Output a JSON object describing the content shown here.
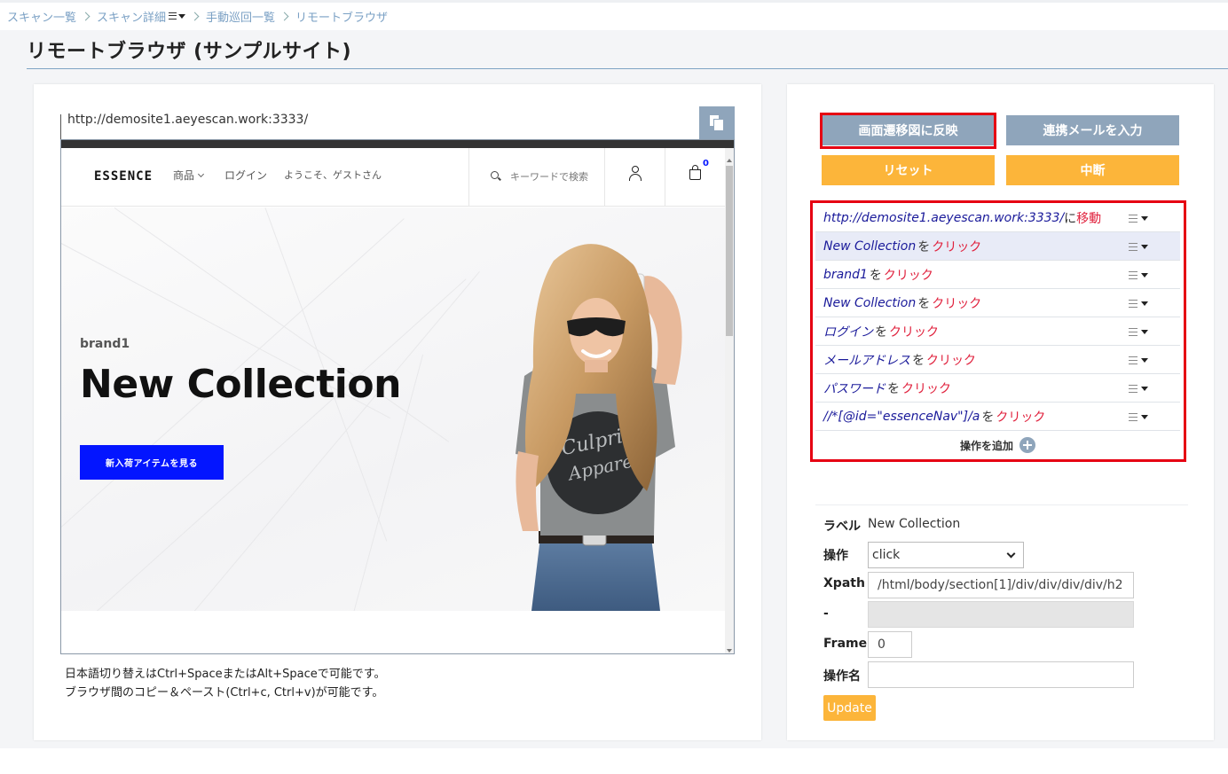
{
  "breadcrumb": [
    "スキャン一覧",
    "スキャン詳細",
    "手動巡回一覧",
    "リモートブラウザ"
  ],
  "page_title": "リモートブラウザ (サンプルサイト)",
  "browser": {
    "url": "http://demosite1.aeyescan.work:3333/",
    "site": {
      "logo": "ESSENCE",
      "nav": [
        "商品",
        "ログイン",
        "ようこそ、ゲストさん"
      ],
      "search_placeholder": "キーワードで検索",
      "cart_count": "0",
      "hero_brand": "brand1",
      "hero_title": "New Collection",
      "hero_button": "新入荷アイテムを見る",
      "tshirt_text_1": "Culprit",
      "tshirt_text_2": "Appare"
    }
  },
  "help": [
    "日本語切り替えはCtrl+SpaceまたはAlt+Spaceで可能です。",
    "ブラウザ間のコピー＆ペースト(Ctrl+c, Ctrl+v)が可能です。"
  ],
  "actions": {
    "reflect": "画面遷移図に反映",
    "mail": "連携メールを入力",
    "reset": "リセット",
    "abort": "中断"
  },
  "operations": [
    {
      "target": "http://demosite1.aeyescan.work:3333/",
      "particle": "に",
      "verb": "移動"
    },
    {
      "target": "New Collection",
      "particle": "を",
      "verb": "クリック",
      "active": true
    },
    {
      "target": "brand1",
      "particle": "を",
      "verb": "クリック"
    },
    {
      "target": "New Collection",
      "particle": "を",
      "verb": "クリック"
    },
    {
      "target": "ログイン",
      "particle": "を",
      "verb": "クリック"
    },
    {
      "target": "メールアドレス",
      "particle": "を",
      "verb": "クリック"
    },
    {
      "target": "パスワード",
      "particle": "を",
      "verb": "クリック"
    },
    {
      "target": "//*[@id=\"essenceNav\"]/a",
      "particle": "を",
      "verb": "クリック"
    }
  ],
  "add_operation": "操作を追加",
  "form": {
    "label_label": "ラベル",
    "label_value": "New Collection",
    "op_label": "操作",
    "op_value": "click",
    "xpath_label": "Xpath",
    "xpath_value": "/html/body/section[1]/div/div/div/div/h2",
    "dash_label": "-",
    "frame_label": "Frame",
    "frame_value": "0",
    "opname_label": "操作名",
    "opname_value": "",
    "update": "Update"
  },
  "colors": {
    "accent_gray": "#8fa5bb",
    "accent_orange": "#fcb53a",
    "highlight_red": "#e60012",
    "site_blue": "#0315ff"
  }
}
